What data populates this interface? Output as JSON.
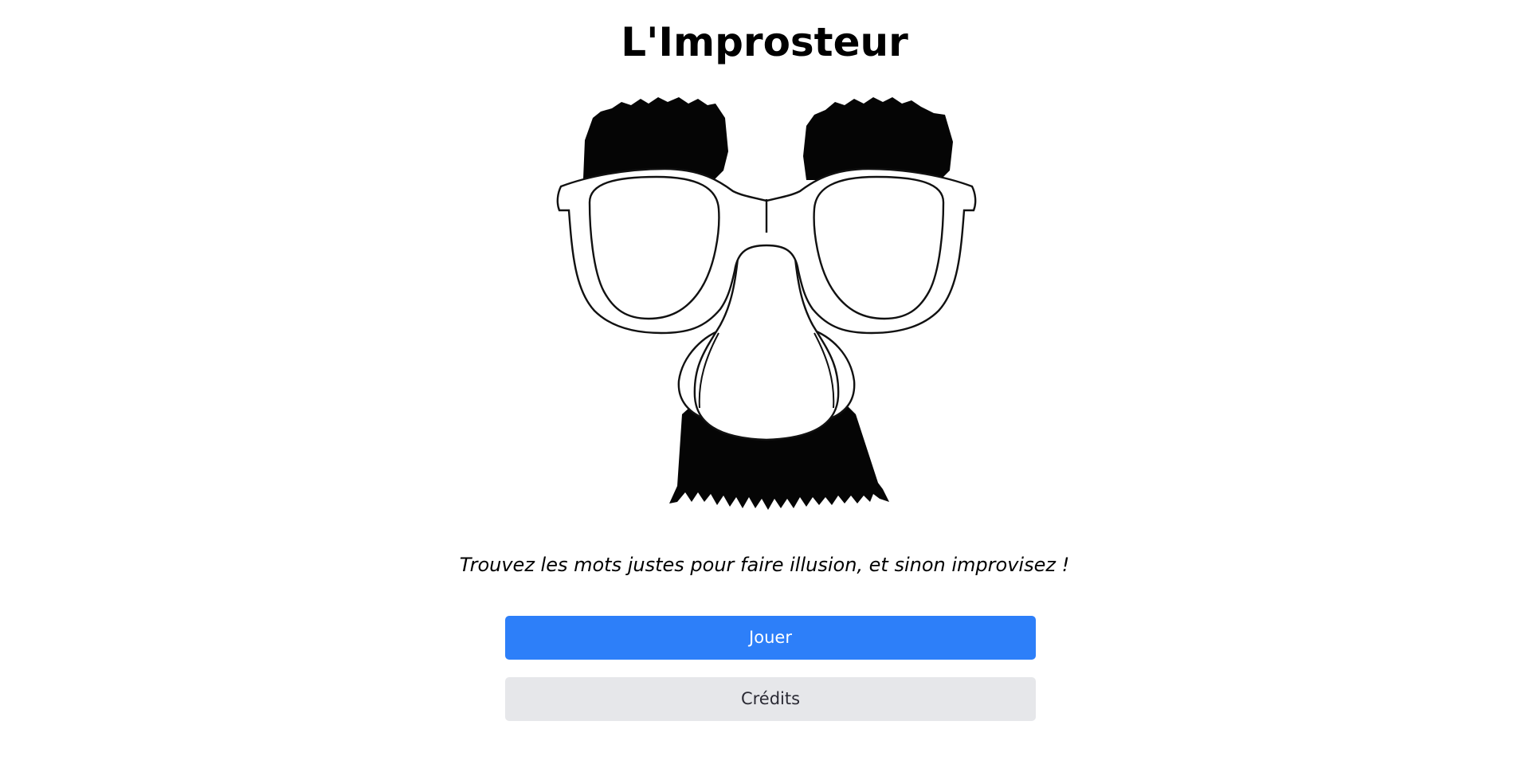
{
  "header": {
    "title": "L'Improsteur"
  },
  "logo": {
    "icon": "groucho-glasses-disguise-icon"
  },
  "intro": {
    "tagline": "Trouvez les mots justes pour faire illusion, et sinon improvisez !"
  },
  "actions": {
    "play_label": "Jouer",
    "credits_label": "Crédits"
  },
  "colors": {
    "primary": "#2d7ff9",
    "secondary": "#e6e7ea",
    "text": "#000000"
  }
}
